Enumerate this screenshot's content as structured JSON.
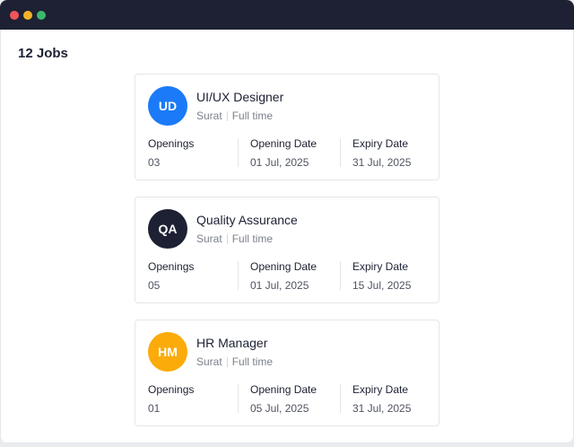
{
  "window": {
    "dots": [
      {
        "name": "close",
        "color": "#f2545b"
      },
      {
        "name": "minimize",
        "color": "#f5b32b"
      },
      {
        "name": "maximize",
        "color": "#3bb96b"
      }
    ]
  },
  "header": {
    "jobs_count": "12 Jobs"
  },
  "labels": {
    "openings": "Openings",
    "opening_date": "Opening Date",
    "expiry_date": "Expiry Date"
  },
  "jobs": [
    {
      "initials": "UD",
      "avatar_color": "#1a7af8",
      "title": "UI/UX Designer",
      "location": "Surat",
      "type": "Full time",
      "openings": "03",
      "opening_date": "01 Jul, 2025",
      "expiry_date": "31 Jul, 2025"
    },
    {
      "initials": "QA",
      "avatar_color": "#1d2133",
      "title": "Quality Assurance",
      "location": "Surat",
      "type": "Full time",
      "openings": "05",
      "opening_date": "01 Jul, 2025",
      "expiry_date": "15 Jul, 2025"
    },
    {
      "initials": "HM",
      "avatar_color": "#fbab0a",
      "title": "HR Manager",
      "location": "Surat",
      "type": "Full time",
      "openings": "01",
      "opening_date": "05 Jul, 2025",
      "expiry_date": "31 Jul, 2025"
    }
  ]
}
